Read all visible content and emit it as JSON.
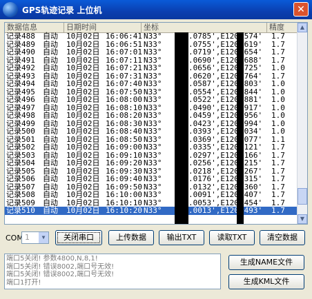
{
  "window": {
    "title": "GPS轨迹记录  上位机",
    "close_label": "✕"
  },
  "columns": [
    "数据信息",
    "日期时间",
    "坐标",
    "精度"
  ],
  "rows": [
    [
      "记录488",
      "自动",
      "10月02日",
      "16:06:41",
      "N33°",
      ".0785',E120°",
      "2574'",
      "1.7"
    ],
    [
      "记录489",
      "自动",
      "10月02日",
      "16:06:51",
      "N33°",
      ".0755',E120°",
      "2619'",
      "1.7"
    ],
    [
      "记录490",
      "自动",
      "10月02日",
      "16:07:01",
      "N33°",
      ".0719',E120°",
      "2654'",
      "1.7"
    ],
    [
      "记录491",
      "自动",
      "10月02日",
      "16:07:11",
      "N33°",
      ".0690',E120°",
      "2688'",
      "1.7"
    ],
    [
      "记录492",
      "自动",
      "10月02日",
      "16:07:21",
      "N33°",
      ".0656',E120°",
      "2725'",
      "1.0"
    ],
    [
      "记录493",
      "自动",
      "10月02日",
      "16:07:31",
      "N33°",
      ".0620',E120°",
      "2764'",
      "1.7"
    ],
    [
      "记录494",
      "自动",
      "10月02日",
      "16:07:40",
      "N33°",
      ".0587',E120°",
      "2803'",
      "1.0"
    ],
    [
      "记录495",
      "自动",
      "10月02日",
      "16:07:50",
      "N33°",
      ".0554',E120°",
      "2844'",
      "1.0"
    ],
    [
      "记录496",
      "自动",
      "10月02日",
      "16:08:00",
      "N33°",
      ".0522',E120°",
      "2881'",
      "1.0"
    ],
    [
      "记录497",
      "自动",
      "10月02日",
      "16:08:10",
      "N33°",
      ".0490',E120°",
      "2917'",
      "1.0"
    ],
    [
      "记录498",
      "自动",
      "10月02日",
      "16:08:20",
      "N33°",
      ".0459',E120°",
      "2956'",
      "1.0"
    ],
    [
      "记录499",
      "自动",
      "10月02日",
      "16:08:30",
      "N33°",
      ".0423',E120°",
      "2994'",
      "1.0"
    ],
    [
      "记录500",
      "自动",
      "10月02日",
      "16:08:40",
      "N33°",
      ".0393',E120°",
      "3034'",
      "1.0"
    ],
    [
      "记录501",
      "自动",
      "10月02日",
      "16:08:50",
      "N33°",
      ".0369',E120°",
      "3077'",
      "1.1"
    ],
    [
      "记录502",
      "自动",
      "10月02日",
      "16:09:00",
      "N33°",
      ".0335',E120°",
      "3121'",
      "1.7"
    ],
    [
      "记录503",
      "自动",
      "10月02日",
      "16:09:10",
      "N33°",
      ".0297',E120°",
      "3166'",
      "1.7"
    ],
    [
      "记录504",
      "自动",
      "10月02日",
      "16:09:20",
      "N33°",
      ".0256',E120°",
      "3215'",
      "1.7"
    ],
    [
      "记录505",
      "自动",
      "10月02日",
      "16:09:30",
      "N33°",
      ".0218',E120°",
      "3267'",
      "1.7"
    ],
    [
      "记录506",
      "自动",
      "10月02日",
      "16:09:40",
      "N33°",
      ".0176',E120°",
      "3315'",
      "1.7"
    ],
    [
      "记录507",
      "自动",
      "10月02日",
      "16:09:50",
      "N33°",
      ".0132',E120°",
      "3360'",
      "1.7"
    ],
    [
      "记录508",
      "自动",
      "10月02日",
      "16:10:00",
      "N33°",
      ".0091',E120°",
      "3407'",
      "1.7"
    ],
    [
      "记录509",
      "自动",
      "10月02日",
      "16:10:10",
      "N33°",
      ".0053',E120°",
      "3454'",
      "1.7"
    ],
    [
      "记录510",
      "自动",
      "10月02日",
      "16:10:20",
      "N33°",
      ".0013',E120°",
      "3493'",
      "1.7"
    ]
  ],
  "selected_row": 22,
  "com": {
    "label": "COM:",
    "value": "1"
  },
  "buttons": {
    "close_port": "关闭串口",
    "upload": "上传数据",
    "export_txt": "输出TXT",
    "read_txt": "读取TXT",
    "clear": "清空数据",
    "gen_name": "生成NAME文件",
    "gen_kml": "生成KML文件"
  },
  "log": [
    "端口5关闭! 参数4800,N,8,1!",
    "端口5关闭! 错误8002,端口号无效!",
    "端口5关闭! 错误8002,端口号无效!",
    "端口1打开!"
  ],
  "colors": {
    "selection": "#316ac5",
    "titlebar": "#0a3fb0"
  }
}
